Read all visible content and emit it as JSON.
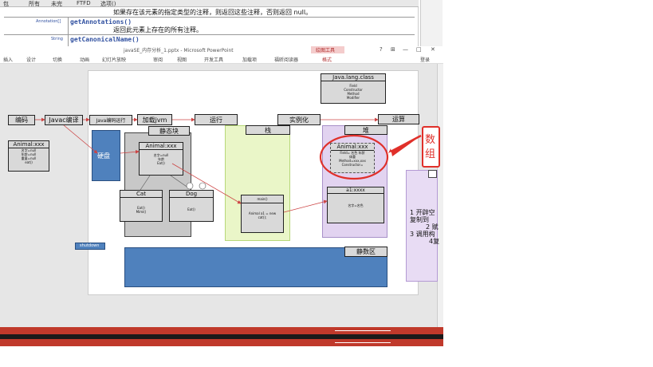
{
  "javadoc": {
    "nav": [
      "包",
      "所有",
      "未完",
      "FTFD",
      "选项()"
    ],
    "line1": "如果存在该元素的指定类型的注释，则返回这些注释，否则返回 null。",
    "anno_link": "Annotation[]",
    "method1": "getAnnotations()",
    "desc1": "返回此元素上存在的所有注释。",
    "string_link": "String",
    "method2": "getCanonicalName()"
  },
  "ppt": {
    "title": "javaSE_内存分析_1.pptx - Microsoft PowerPoint",
    "drawing_tools": "绘图工具",
    "win_btns": [
      "?",
      "⊞",
      "—",
      "□",
      "✕"
    ],
    "tabs": [
      "插入",
      "设计",
      "切换",
      "动画",
      "幻灯片放映",
      "审阅",
      "视图",
      "开发工具",
      "加载项",
      "福昕阅读器",
      "格式"
    ],
    "login": "登录"
  },
  "slide": {
    "flow": [
      "编码",
      "Javac编译",
      "Java编码运行",
      "加载jvm",
      "运行",
      "实例化",
      "运算"
    ],
    "disk": "硬盘",
    "animal_left": {
      "title": "Animal:xxx",
      "lines": [
        "名字=null",
        "年龄=null",
        "重量=null",
        "eat()"
      ]
    },
    "static_area": "静态块",
    "animal_mid": {
      "title": "Animal:xxx",
      "lines": [
        "名字=null",
        "年龄",
        "Eat()"
      ]
    },
    "cat": {
      "title": "Cat",
      "lines": [
        "Eat()",
        "Mimi()"
      ]
    },
    "dog": {
      "title": "Dog",
      "lines": [
        "Eat()"
      ]
    },
    "stack": "栈",
    "main_box": {
      "title": "main()",
      "lines": [
        "Animal a1 = new",
        "cat();"
      ]
    },
    "heap": "堆",
    "class_box": {
      "title": "Java.lang.class",
      "lines": [
        "Field",
        "Constructor",
        "Method",
        "Modifier"
      ]
    },
    "heap_animal": {
      "title": "Animal:xxx",
      "lines": [
        "Field= 名色 年龄",
        "体重",
        "Method=xxx,xxx",
        "Constructor="
      ]
    },
    "a1_box": {
      "title": "a1:xxxx",
      "lines": [
        "名字=名色"
      ]
    },
    "callout": [
      "数",
      "组"
    ],
    "right_text": [
      "1 开辟空",
      "复制到",
      "2 赋",
      "3 调用构",
      "4复"
    ],
    "static_data": "静数区",
    "shutdown": "shutdown"
  },
  "colors": {
    "ribbon_red": "#c0392b",
    "disk_blue": "#4f81bd",
    "stack_green": "#eaf6c8",
    "heap_purple": "#e2d3f0",
    "callout_red": "#e0302a"
  }
}
